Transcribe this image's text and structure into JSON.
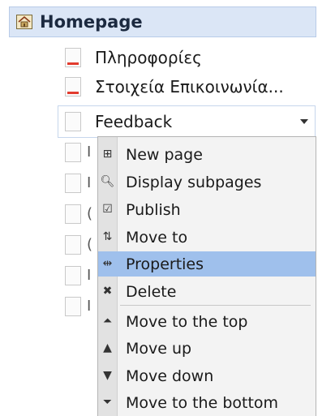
{
  "tree": {
    "root": {
      "label": "Homepage"
    },
    "items": [
      {
        "label": "Πληροφορίες",
        "marked": true
      },
      {
        "label": "Στοιχεία Επικοινωνία...",
        "marked": true
      },
      {
        "label": "Feedback",
        "selected": true
      }
    ],
    "hidden_item_fragments": [
      "I",
      "I",
      "(",
      "(",
      "I",
      "I"
    ]
  },
  "context_menu": {
    "items": [
      {
        "label": "New page",
        "icon": "plus-box-icon"
      },
      {
        "label": "Display subpages",
        "icon": "magnifier-icon"
      },
      {
        "label": "Publish",
        "icon": "checkbox-icon"
      },
      {
        "label": "Move to",
        "icon": "move-arrows-icon"
      },
      {
        "label": "Properties",
        "icon": "properties-icon",
        "highlighted": true
      },
      {
        "label": "Delete",
        "icon": "delete-x-icon"
      },
      {
        "label": "Move to the top",
        "icon": "move-top-icon"
      },
      {
        "label": "Move up",
        "icon": "move-up-icon"
      },
      {
        "label": "Move down",
        "icon": "move-down-icon"
      },
      {
        "label": "Move to the bottom",
        "icon": "move-bottom-icon"
      }
    ]
  },
  "colors": {
    "root_row_bg": "#dbe6f6",
    "menu_highlight": "#9fc0ec",
    "marker_red": "#e23b2e"
  }
}
